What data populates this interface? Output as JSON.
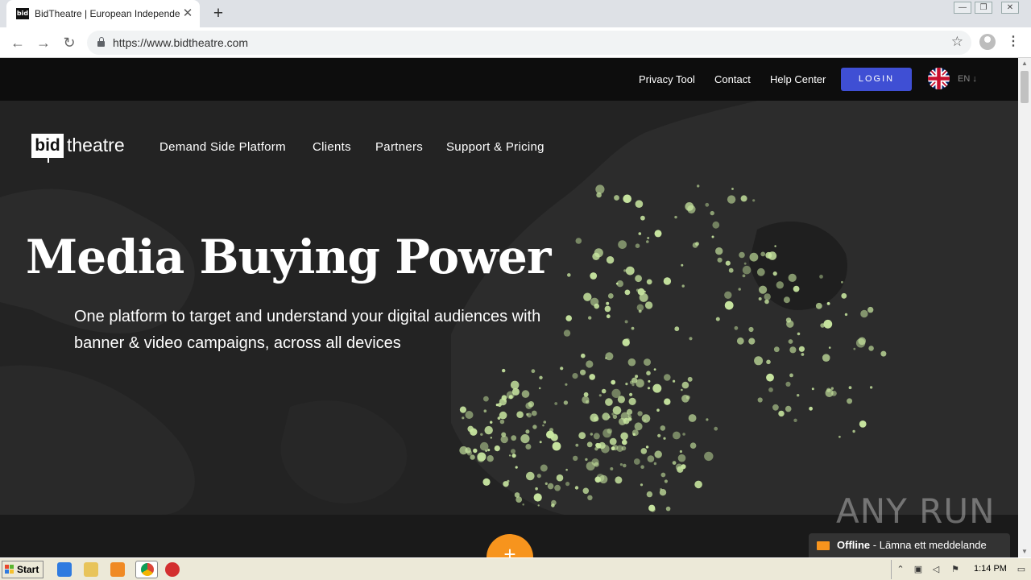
{
  "browser": {
    "tab_title": "BidTheatre | European Independent",
    "favicon_text": "bid",
    "url": "https://www.bidtheatre.com",
    "window_controls": [
      "minimize-icon",
      "restore-icon",
      "close-icon"
    ]
  },
  "topbar": {
    "links": [
      "Privacy Tool",
      "Contact",
      "Help Center"
    ],
    "login_label": "LOGIN",
    "language": "EN ↓",
    "flag_icon": "uk-flag-icon"
  },
  "nav": {
    "logo_box": "bid",
    "logo_text": "theatre",
    "links": [
      "Demand Side Platform",
      "Clients",
      "Partners",
      "Support & Pricing"
    ]
  },
  "hero": {
    "headline": "Media Buying Power",
    "subline_1": "One platform to target and understand your digital audiences with",
    "subline_2": "banner & video campaigns, across all devices"
  },
  "footer": {
    "plus_label": "+",
    "watermark": "ANY RUN",
    "chat_status": "Offline",
    "chat_message": " - Lämna ett meddelande"
  },
  "taskbar": {
    "start_label": "Start",
    "clock": "1:14 PM"
  },
  "colors": {
    "accent": "#3f4fd4",
    "orange": "#f7941d",
    "map_dots": "#c8e6a0"
  }
}
